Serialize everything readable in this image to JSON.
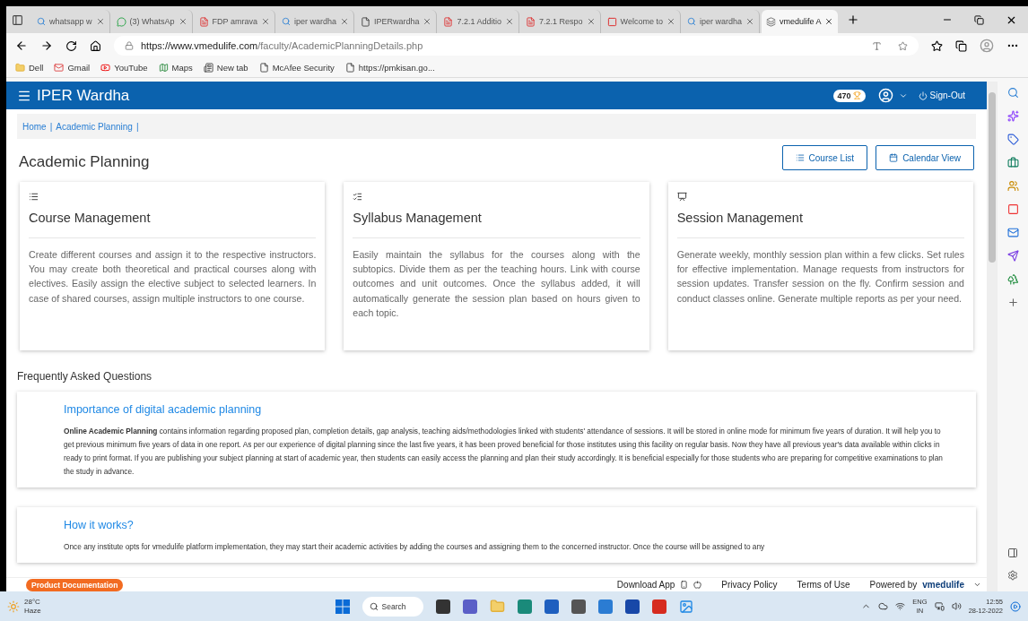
{
  "browser": {
    "tabs": [
      {
        "title": "whatsapp w",
        "selected": false
      },
      {
        "title": "(3) WhatsAp",
        "selected": false
      },
      {
        "title": "FDP amrava",
        "selected": false
      },
      {
        "title": "iper wardha",
        "selected": false
      },
      {
        "title": "IPERwardha",
        "selected": false
      },
      {
        "title": "7.2.1 Additio",
        "selected": false
      },
      {
        "title": "7.2.1 Respo",
        "selected": false
      },
      {
        "title": "Welcome to",
        "selected": false
      },
      {
        "title": "iper wardha",
        "selected": false
      },
      {
        "title": "vmedulife A",
        "selected": true
      }
    ],
    "url_host": "https://www.vmedulife.com",
    "url_path": "/faculty/AcademicPlanningDetails.php",
    "bookmarks": [
      "Dell",
      "Gmail",
      "YouTube",
      "Maps",
      "New tab",
      "McAfee Security",
      "https://pmkisan.go..."
    ]
  },
  "header": {
    "title": "IPER Wardha",
    "points": "470",
    "signout": "Sign-Out"
  },
  "breadcrumb": {
    "items": [
      "Home",
      "Academic Planning"
    ],
    "separator": "|"
  },
  "page_title": "Academic Planning",
  "buttons": [
    "Course List",
    "Calendar View"
  ],
  "cards": [
    {
      "title": "Course Management",
      "text": "Create different courses and assign it to the respective instructors. You may create both theoretical and practical courses along with electives. Easily assign the elective subject to selected learners. In case of shared courses, assign multiple instructors to one course."
    },
    {
      "title": "Syllabus Management",
      "text": "Easily maintain the syllabus for the courses along with the subtopics. Divide them as per the teaching hours. Link with course outcomes and unit outcomes. Once the syllabus added, it will automatically generate the session plan based on hours given to each topic."
    },
    {
      "title": "Session Management",
      "text": "Generate weekly, monthly session plan within a few clicks. Set rules for effective implementation. Manage requests from instructors for session updates. Transfer session on the fly. Confirm session and conduct classes online. Generate multiple reports as per your need."
    }
  ],
  "faq": {
    "heading": "Frequently Asked Questions",
    "items": [
      {
        "question": "Importance of digital academic planning",
        "answer": "**Online Academic Planning** contains information regarding proposed plan, completion details, gap analysis, teaching aids/methodologies linked with students' attendance of sessions. It will be stored in online mode for minimum five years of duration. It will help you to get previous minimum five years of data in one report. As per our experience of digital planning since the last five years, it has been proved beneficial for those institutes using this facility on regular basis. Now they have all previous year's data available within clicks in ready to print format. If you are publishing your subject planning at start of academic year, then students can easily access the planning and plan their study accordingly. It is beneficial especially for those students who are preparing for competitive examinations to plan the study in advance."
      },
      {
        "question": "How it works?",
        "answer": "Once any institute opts for vmedulife platform implementation, they may start their academic activities by adding the courses and assigning them to the concerned instructor. Once the course will be assigned to any"
      }
    ]
  },
  "footer": {
    "badge": "Product Documentation",
    "download": "Download App",
    "links": [
      "Privacy Policy",
      "Terms of Use"
    ],
    "powered": "Powered by",
    "brand": "vmedulife"
  },
  "taskbar": {
    "temp": "28°C",
    "weather": "Haze",
    "search": "Search",
    "lang": "ENG",
    "region": "IN",
    "time": "12:55",
    "date": "28-12-2022"
  }
}
